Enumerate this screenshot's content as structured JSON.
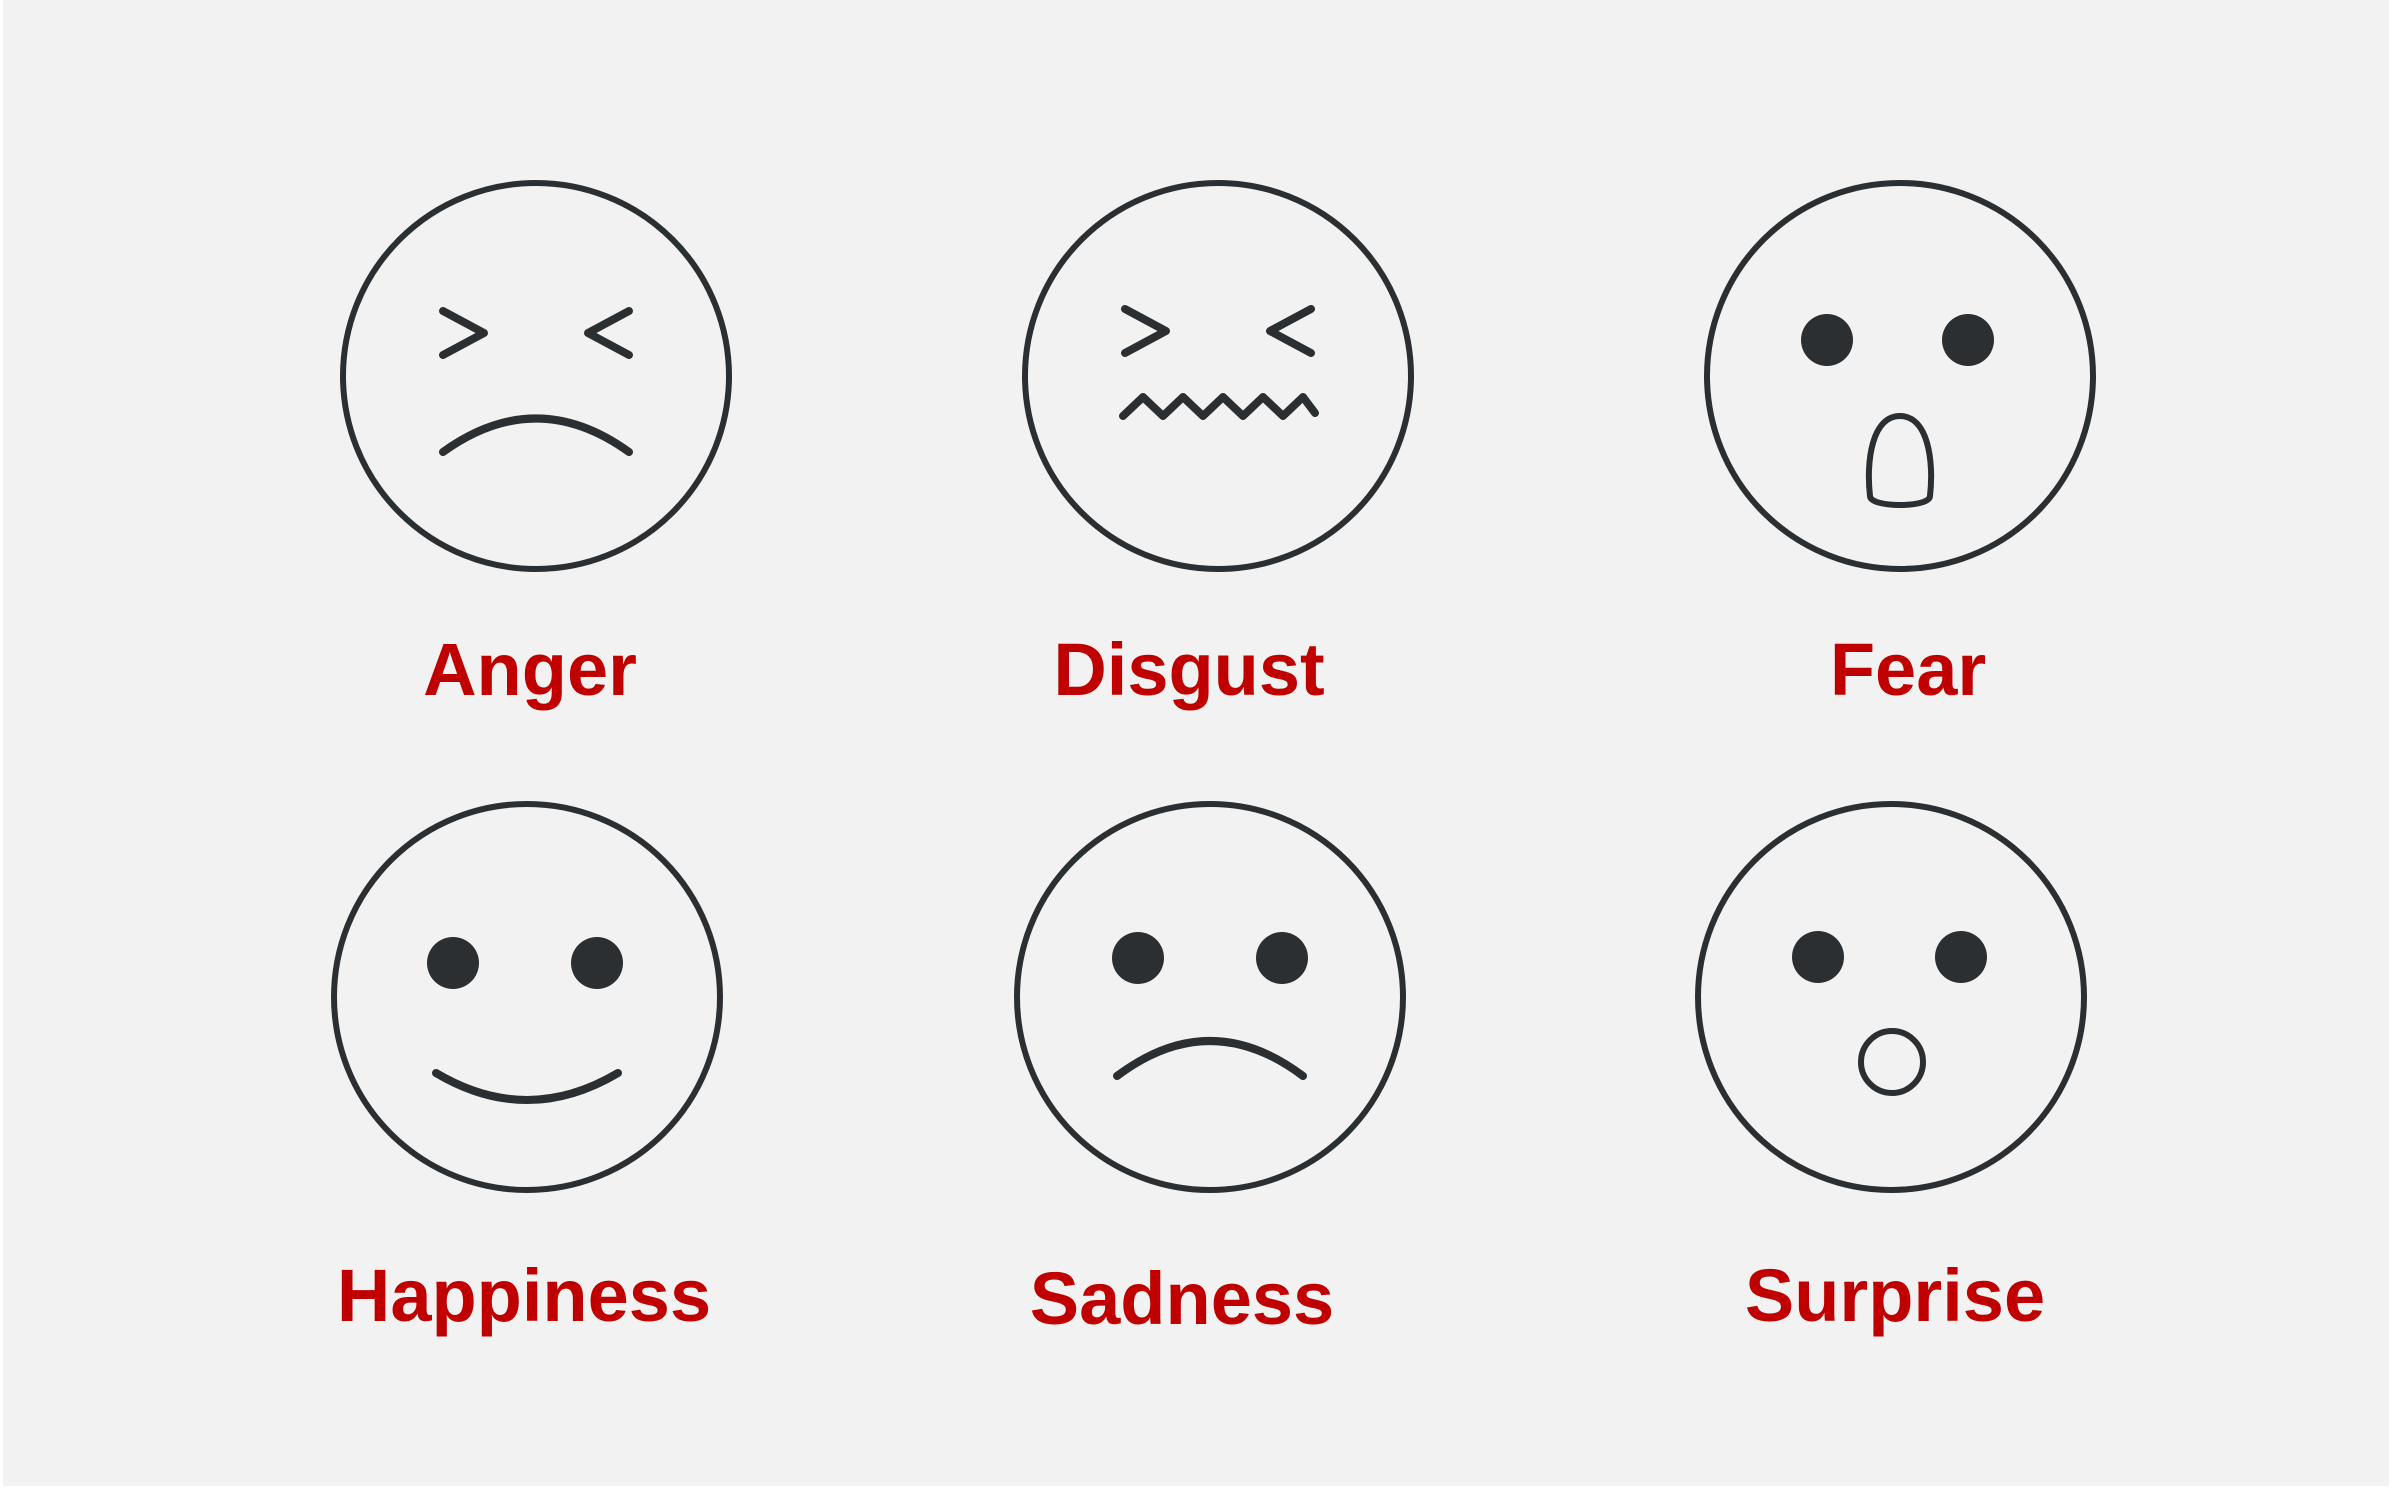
{
  "colors": {
    "background": "#f2f2f2",
    "label": "#c00000",
    "outline": "#2b2f31"
  },
  "emotions": [
    {
      "label": "Anger",
      "icon": "angry-face-icon"
    },
    {
      "label": "Disgust",
      "icon": "disgusted-face-icon"
    },
    {
      "label": "Fear",
      "icon": "fearful-face-icon"
    },
    {
      "label": "Happiness",
      "icon": "happy-face-icon"
    },
    {
      "label": "Sadness",
      "icon": "sad-face-icon"
    },
    {
      "label": "Surprise",
      "icon": "surprised-face-icon"
    }
  ]
}
